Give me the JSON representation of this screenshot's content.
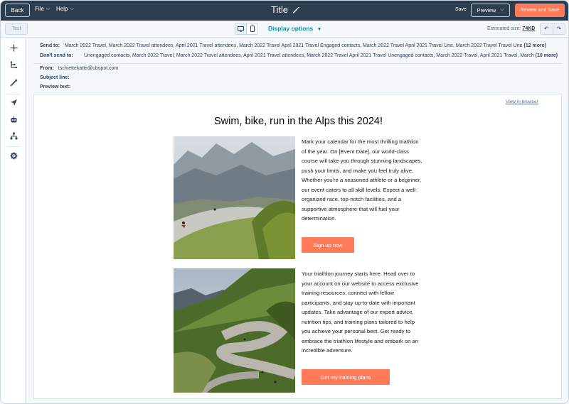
{
  "topbar": {
    "back_label": "Back",
    "file_label": "File",
    "help_label": "Help",
    "title": "Title",
    "save_label": "Save",
    "preview_label": "Preview",
    "review_label": "Review and Save"
  },
  "toolbar": {
    "test_label": "Test",
    "display_options_label": "Display options",
    "estimated_size_label": "Estimated size:",
    "estimated_size_value": "74KB"
  },
  "recipients": {
    "send_to_label": "Send to:",
    "send_to_value": "March 2022 Travel, March 2022 Travel attendees, April 2021 Travel attendees, March 2022 Travel April 2021 Travel Engaged contacts, March 2022 Travel April 2021 Travel Une, March 2022 Travel  Travel Une",
    "send_to_count": "(12 more)",
    "dont_send_label": "Don't send to:",
    "dont_send_value": "Unengaged contacts, March 2022 Travel, March 2022 Travel attendees, April 2021 Travel attendees, March 2022 Travel April 2021 Travel Unengaged contacts, March 2022 Travel, April 2021 Travel, March",
    "dont_send_count": "(10 more)"
  },
  "fields": {
    "from_label": "From:",
    "from_value": "tschiettekatte@ubspot.com",
    "subject_label": "Subject line:",
    "preview_text_label": "Preview text:"
  },
  "email": {
    "view_in_browser": "View in browser",
    "headline": "Swim, bike, run in the Alps this 2024!",
    "block1_text": "Mark your calendar for the most thrilling triathlon of the year. On [Event Date], our world-class course will take you through stunning landscapes, push your limits, and make you feel truly alive. Whether you're a seasoned athlete or a beginner, our event caters to all skill levels. Expect a well-organized race, top-notch facilities, and a supportive atmosphere that will fuel your determination.",
    "block1_cta": "Sign up now",
    "block2_text": "Your triathlon journey starts here. Head over to your account on our website to access exclusive training resources, connect with fellow participants, and stay up-to-date with important updates. Take advantage of our expert advice, nutrition tips, and training plans tailored to help you achieve your personal best. Get ready to embrace the triathlon lifestyle and embark on an incredible adventure.",
    "block2_cta": "Get my training plans"
  },
  "sidebar": {
    "icons": [
      "plus-icon",
      "structure-icon",
      "brush-icon",
      "send-icon",
      "robot-icon",
      "org-chart-icon",
      "settings-icon"
    ]
  },
  "colors": {
    "topbar_bg": "#2d3e50",
    "accent": "#ff7a59",
    "link": "#0091ae"
  }
}
